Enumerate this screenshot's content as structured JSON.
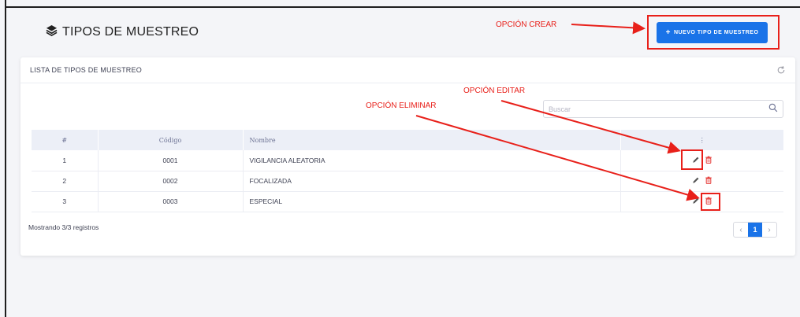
{
  "header": {
    "title": "TIPOS DE MUESTREO",
    "icon": "layers-icon"
  },
  "toolbar": {
    "new_label": "NUEVO TIPO DE MUESTREO",
    "new_icon": "plus-icon"
  },
  "card": {
    "title": "LISTA DE TIPOS DE MUESTREO",
    "refresh_icon": "refresh-icon"
  },
  "search": {
    "placeholder": "Buscar",
    "value": ""
  },
  "table": {
    "headers": [
      "#",
      "Código",
      "Nombre",
      "⋮"
    ],
    "rows": [
      {
        "num": "1",
        "code": "0001",
        "name": "VIGILANCIA ALEATORIA"
      },
      {
        "num": "2",
        "code": "0002",
        "name": "FOCALIZADA"
      },
      {
        "num": "3",
        "code": "0003",
        "name": "ESPECIAL"
      }
    ]
  },
  "footer": {
    "records": "Mostrando 3/3 registros"
  },
  "pager": {
    "prev": "‹",
    "current": "1",
    "next": "›"
  },
  "annotations": {
    "crear": "OPCIÓN CREAR",
    "editar": "OPCIÓN EDITAR",
    "eliminar": "OPCIÓN ELIMINAR"
  },
  "colors": {
    "primary": "#1a73e8",
    "annotation": "#e8201a",
    "delete": "#e53935"
  }
}
